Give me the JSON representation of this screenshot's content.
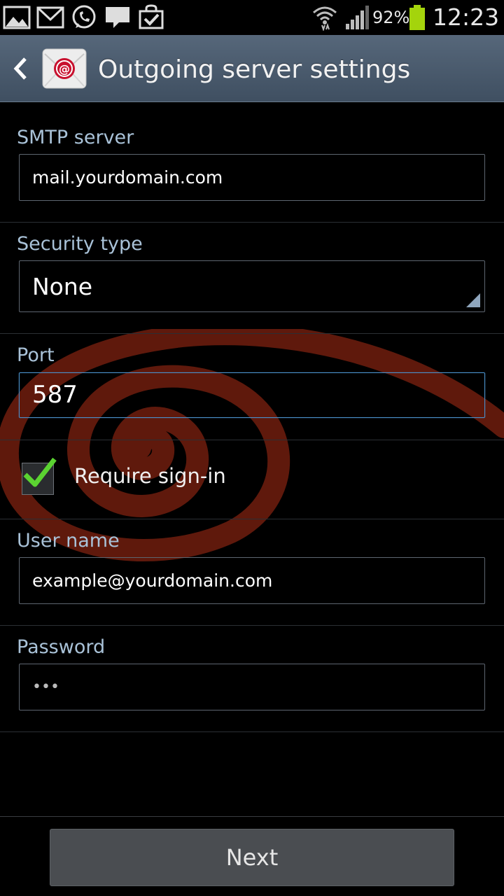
{
  "status_bar": {
    "battery_percent": "92%",
    "time": "12:23",
    "icons": [
      "gallery-icon",
      "gmail-icon",
      "whatsapp-icon",
      "message-icon",
      "play-store-icon",
      "wifi-icon",
      "signal-icon",
      "battery-icon"
    ]
  },
  "action_bar": {
    "title": "Outgoing server settings",
    "app_icon": "email-app-icon",
    "back_icon": "back-arrow-icon"
  },
  "form": {
    "smtp_server": {
      "label": "SMTP server",
      "value": "mail.yourdomain.com"
    },
    "security_type": {
      "label": "Security type",
      "value": "None"
    },
    "port": {
      "label": "Port",
      "value": "587"
    },
    "require_sign_in": {
      "label": "Require sign-in",
      "checked": true
    },
    "user_name": {
      "label": "User name",
      "value": "example@yourdomain.com"
    },
    "password": {
      "label": "Password",
      "value": "•••"
    }
  },
  "footer": {
    "next_label": "Next"
  },
  "colors": {
    "action_bar": "#4b5c6e",
    "label": "#a9c2d8",
    "focus_border": "#4a8fc8",
    "check_green": "#5bd331",
    "battery_green": "#a4d40c",
    "watermark": "#7a2010"
  }
}
